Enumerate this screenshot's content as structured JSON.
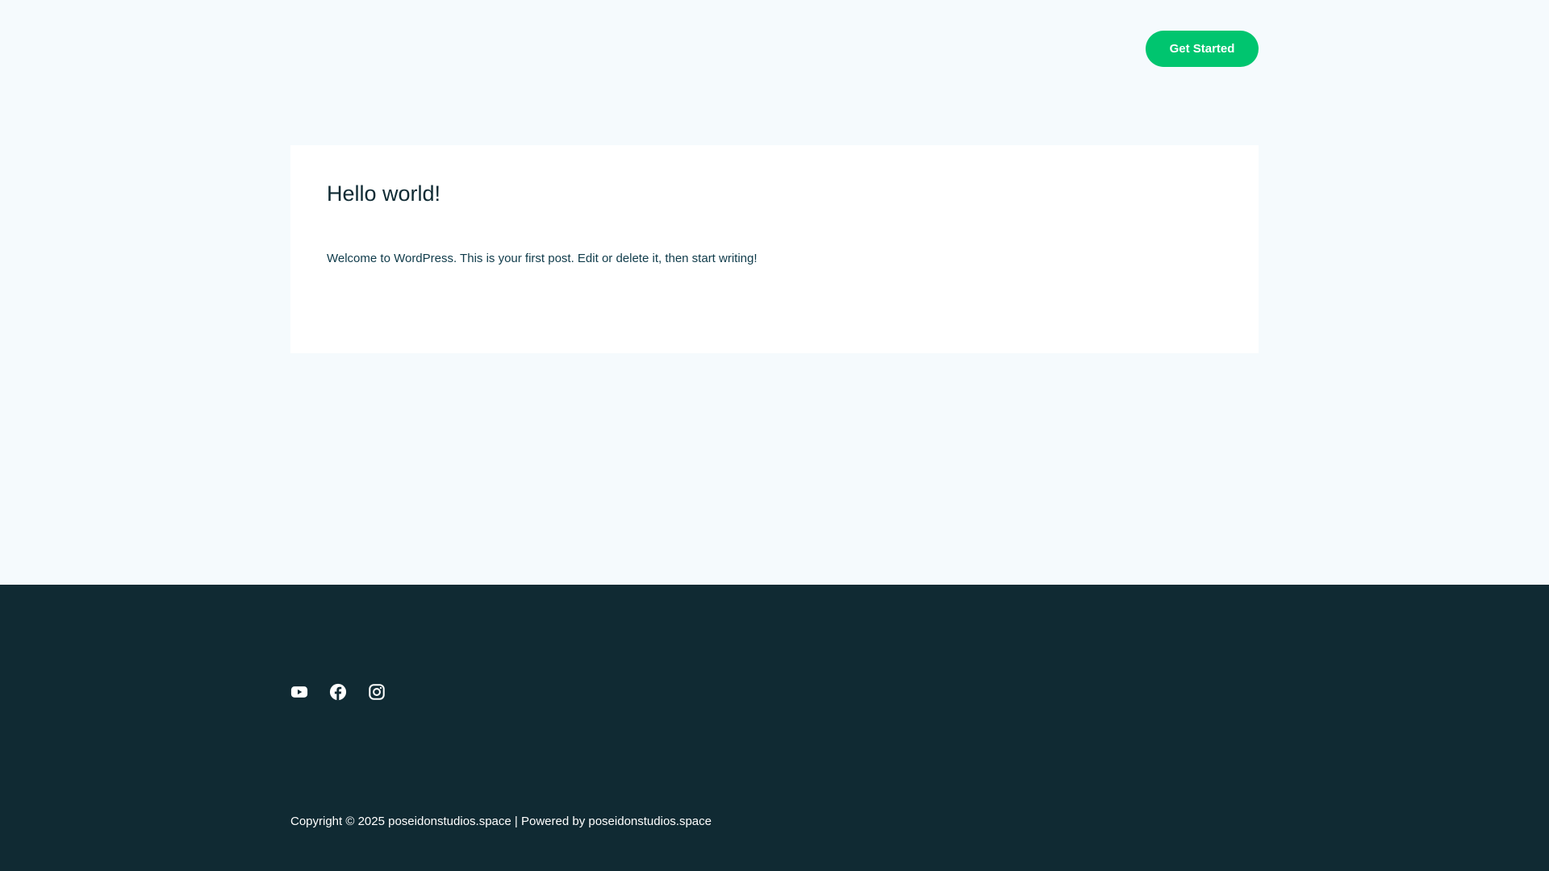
{
  "header": {
    "cta_label": "Get Started"
  },
  "post": {
    "title": "Hello world!",
    "excerpt": "Welcome to WordPress. This is your first post. Edit or delete it, then start writing!"
  },
  "footer": {
    "social": [
      {
        "name": "youtube",
        "icon": "youtube-icon"
      },
      {
        "name": "facebook",
        "icon": "facebook-icon"
      },
      {
        "name": "instagram",
        "icon": "instagram-icon"
      }
    ],
    "copyright_prefix": "Copyright © 2025",
    "site_name": "poseidonstudios.space",
    "separator": "|",
    "powered_by_label": "Powered by",
    "powered_by_name": "poseidonstudios.space"
  },
  "colors": {
    "page_background": "#f5fafd",
    "accent": "#00c56f",
    "footer_background": "#102a33",
    "text_dark": "#0f2a33"
  }
}
